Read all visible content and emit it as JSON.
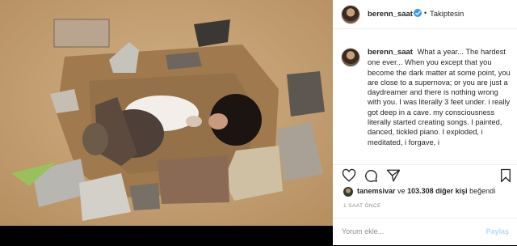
{
  "post": {
    "username": "berenn_saat",
    "header_separator": "•",
    "follow_status": "Takiptesin",
    "caption": "What a year... The hardest one ever... When you except that you become the dark matter at some point, you are close to a supernova; or you are just a daydreamer and there is nothing wrong with you. I was literally 3 feet under. i really got deep in a cave. my consciousness literally started creating songs. I painted, danced, tickled piano. I exploded, i meditated, i forgave, i",
    "likes": {
      "user": "tanemsivar",
      "connector": "ve",
      "count": "103.308 diğer kişi",
      "suffix": "beğendi"
    },
    "timestamp": "1 SAAT ÖNCE",
    "comment_placeholder": "Yorum ekle...",
    "comment_submit": "Paylaş"
  },
  "icons": {
    "like": "heart-icon",
    "comment": "comment-icon",
    "share": "send-icon",
    "save": "bookmark-icon",
    "verified": "verified-badge-icon"
  },
  "colors": {
    "verified": "#3897f0",
    "muted_text": "#8e8e8e",
    "share_button_disabled": "#b3dbff"
  }
}
